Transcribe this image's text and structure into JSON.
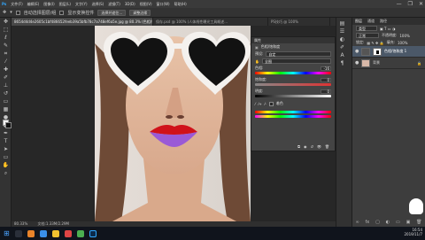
{
  "menu": [
    "文件(F)",
    "编辑(E)",
    "图像(I)",
    "图层(L)",
    "文字(Y)",
    "选择(S)",
    "滤镜(T)",
    "3D(D)",
    "视图(V)",
    "窗口(W)",
    "帮助(H)"
  ],
  "window_controls": [
    "—",
    "❐",
    "✕"
  ],
  "options": {
    "auto_select_label": "自动选择图层/组",
    "color_label": "显示变换控件",
    "btn1": "选择并遮住...",
    "btn2": "调整边缘"
  },
  "tabs": [
    "8654d4d4e2605c1bf486652feeb39a5bfb78c7a748ef6a5e.jpg @ 80.3% (色相/饱和度1, 图层蒙版/8)",
    "保存.psd @ 100% (人体线性曝光工具概述...",
    "PS技巧 @ 100%"
  ],
  "status": {
    "zoom": "80.33%",
    "doc": "文档:1.33M/2.29M"
  },
  "adjust_panel": {
    "tab1": "属性",
    "tab2": "色相/饱和度",
    "preset_label": "预设:",
    "preset_value": "自定",
    "channel_value": "全图",
    "hue_label": "色相:",
    "hue_value": "-16",
    "sat_label": "饱和度:",
    "sat_value": "0",
    "light_label": "明度:",
    "light_value": "0",
    "colorize_label": "着色"
  },
  "layers": {
    "tab1": "图层",
    "tab2": "通道",
    "tab3": "路径",
    "kind": "类型",
    "blend": "正常",
    "opacity_label": "不透明度:",
    "opacity": "100%",
    "lock_label": "锁定:",
    "fill_label": "填充:",
    "fill": "100%",
    "items": [
      {
        "name": "色相/饱和度 1"
      },
      {
        "name": "背景"
      }
    ]
  },
  "clock": {
    "time": "16:54",
    "date": "2019/11/7"
  },
  "colors": {
    "accent": "#4b5868",
    "taskbar": "#10141c"
  }
}
